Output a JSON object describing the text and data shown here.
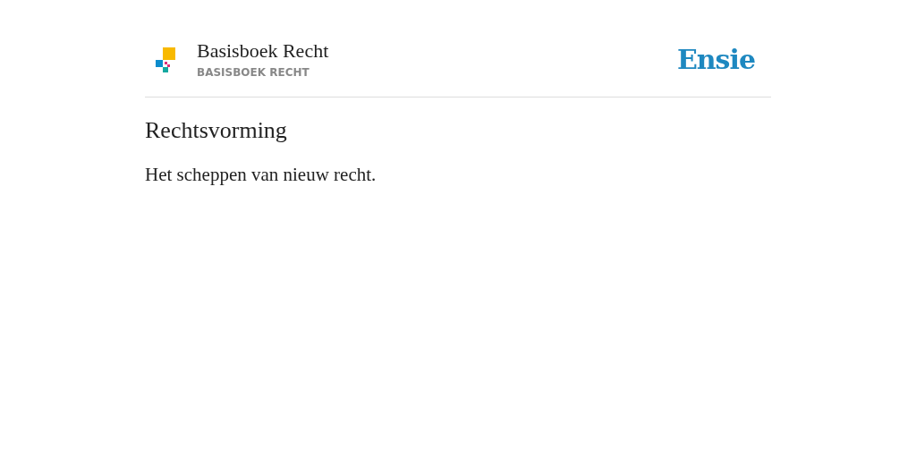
{
  "header": {
    "title": "Basisboek Recht",
    "subtitle": "BASISBOEK RECHT",
    "brand": "Ensie"
  },
  "term": "Rechtsvorming",
  "definition": "Het scheppen van nieuw recht."
}
